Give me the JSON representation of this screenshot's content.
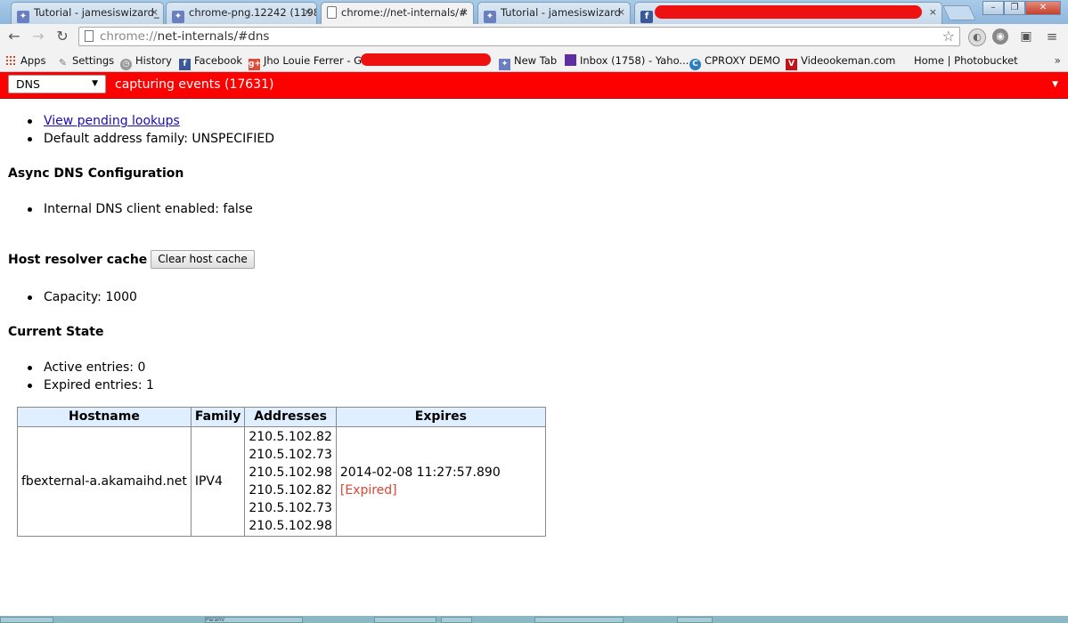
{
  "tabs": [
    {
      "title": "Tutorial - jamesiswizard_",
      "icon": "shield-icon",
      "active": false
    },
    {
      "title": "chrome-png.12242 (1198",
      "icon": "shield-icon",
      "active": false
    },
    {
      "title": "chrome://net-internals/#",
      "icon": "page-icon",
      "active": true
    },
    {
      "title": "Tutorial - jamesiswizard",
      "icon": "shield-icon",
      "active": false
    },
    {
      "title": "",
      "icon": "facebook-icon",
      "active": false
    }
  ],
  "tab_close_glyph": "×",
  "window_controls": {
    "minimize": "–",
    "maximize": "❐",
    "close": "✕"
  },
  "toolbar": {
    "back": "←",
    "forward": "→",
    "reload": "↻",
    "url_scheme": "chrome://",
    "url_rest": "net-internals/#dns",
    "star": "☆"
  },
  "bookmarks": [
    {
      "label": "Apps",
      "icon": "apps-grid-icon"
    },
    {
      "label": "Settings",
      "icon": "wrench-icon"
    },
    {
      "label": "History",
      "icon": "clock-icon"
    },
    {
      "label": "Facebook",
      "icon": "facebook-icon"
    },
    {
      "label": "Jho Louie Ferrer - G...",
      "icon": "google-plus-icon"
    },
    {
      "label": "New Tab",
      "icon": "shield-icon"
    },
    {
      "label": "Inbox (1758) - Yaho...",
      "icon": "yahoo-icon"
    },
    {
      "label": "CPROXY DEMO",
      "icon": "cproxy-icon"
    },
    {
      "label": "Videookeman.com",
      "icon": "video-icon"
    },
    {
      "label": "Home | Photobucket",
      "icon": ""
    }
  ],
  "bookmarks_more": "»",
  "status_bar": {
    "view_select": "DNS",
    "capturing": "capturing events (17631)",
    "menu_glyph": "▼"
  },
  "dns": {
    "view_pending_link": "View pending lookups",
    "default_family": "Default address family: UNSPECIFIED",
    "async_heading": "Async DNS Configuration",
    "internal_client": "Internal DNS client enabled: false",
    "cache_heading": "Host resolver cache",
    "clear_button": "Clear host cache",
    "capacity": "Capacity: 1000",
    "state_heading": "Current State",
    "active_entries": "Active entries: 0",
    "expired_entries": "Expired entries: 1",
    "table": {
      "headers": [
        "Hostname",
        "Family",
        "Addresses",
        "Expires"
      ],
      "rows": [
        {
          "hostname": "fbexternal-a.akamaihd.net",
          "family": "IPV4",
          "addresses": [
            "210.5.102.82",
            "210.5.102.73",
            "210.5.102.98",
            "210.5.102.82",
            "210.5.102.73",
            "210.5.102.98"
          ],
          "expires": "2014-02-08 11:27:57.890",
          "expired_tag": "[Expired]"
        }
      ]
    }
  },
  "taskbar": {
    "item_label": "Paramr"
  },
  "colors": {
    "status_bar": "#ff0000",
    "table_header": "#dfefff",
    "link": "#1a0dab",
    "expired": "#dd4433",
    "redaction": "#ee1111"
  }
}
